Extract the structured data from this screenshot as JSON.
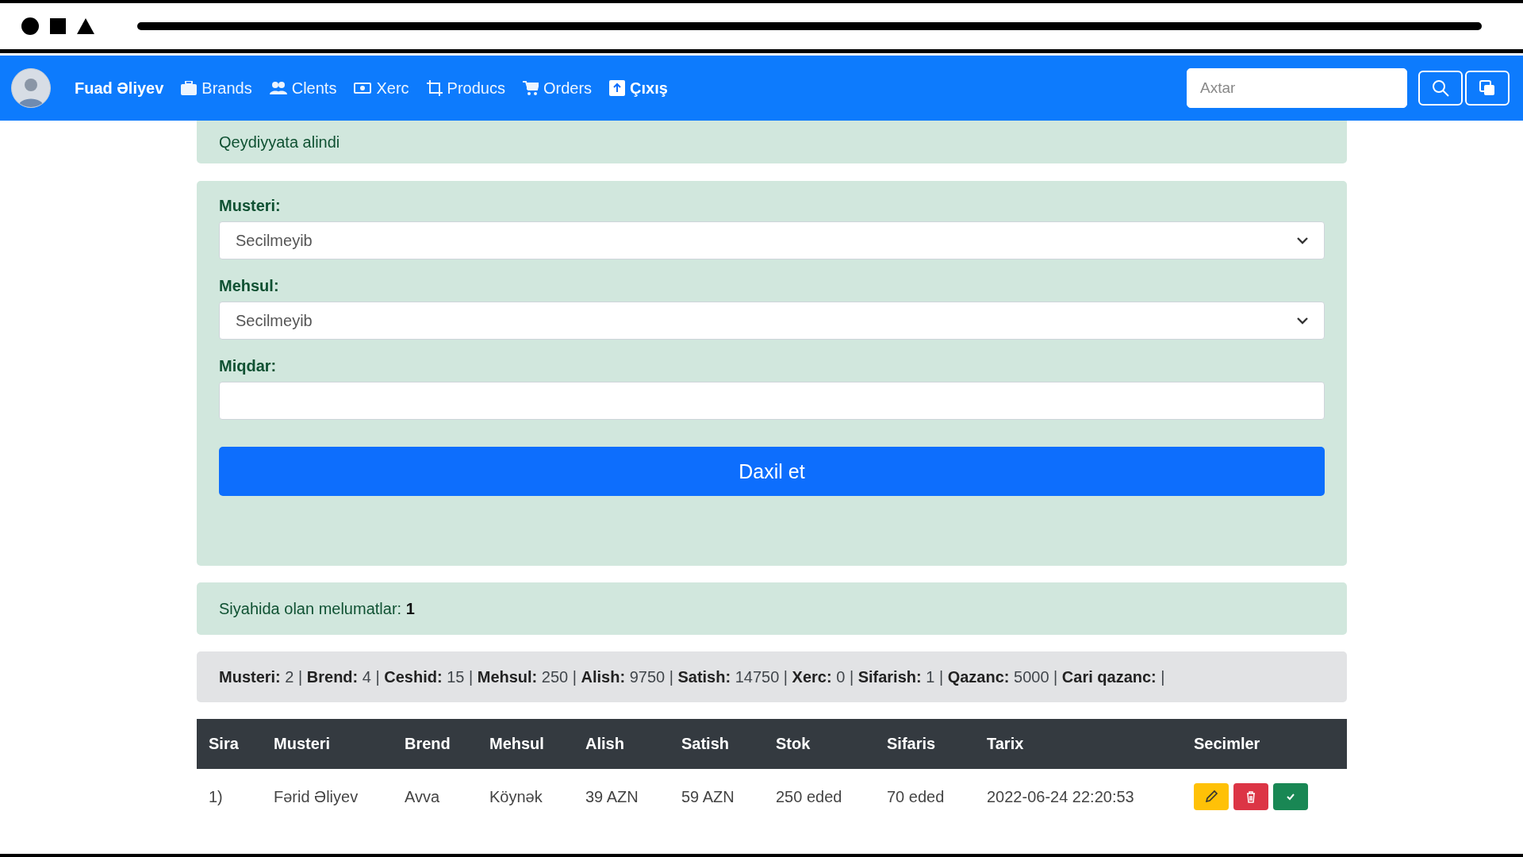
{
  "navbar": {
    "user": "Fuad Əliyev",
    "links": [
      {
        "kind": "brands",
        "label": "Brands"
      },
      {
        "kind": "clients",
        "label": "Clents"
      },
      {
        "kind": "expense",
        "label": "Xerc"
      },
      {
        "kind": "products",
        "label": "Producs"
      },
      {
        "kind": "orders",
        "label": "Orders"
      },
      {
        "kind": "logout",
        "label": "Çıxış"
      }
    ],
    "search": {
      "placeholder": "Axtar"
    }
  },
  "alert": {
    "text": "Qeydiyyata alindi"
  },
  "form": {
    "fields": [
      {
        "kind": "select",
        "label": "Musteri:",
        "value": "Secilmeyib"
      },
      {
        "kind": "select",
        "label": "Mehsul:",
        "value": "Secilmeyib"
      },
      {
        "kind": "input",
        "label": "Miqdar:"
      }
    ],
    "submit": "Daxil et"
  },
  "count_alert": {
    "text": "Siyahida olan melumatlar: **1**"
  },
  "stats": {
    "text": "**Musteri:** 2 | **Brend:** 4 | **Ceshid:** 15 | **Mehsul:** 250 | **Alish:** 9750 | **Satish:** 14750 | **Xerc:** 0 | **Sifarish:** 1 | **Qazanc:** 5000 | **Cari qazanc:** |"
  },
  "table": {
    "columns": [
      "Sira",
      "Musteri",
      "Brend",
      "Mehsul",
      "Alish",
      "Satish",
      "Stok",
      "Sifaris",
      "Tarix",
      "Secimler"
    ],
    "rows": [
      {
        "cells": [
          "1)",
          "Fərid Əliyev",
          "Avva",
          "Köynək",
          "39 AZN",
          "59 AZN",
          "250 eded",
          "70 eded",
          "2022-06-24 22:20:53"
        ],
        "actions": [
          {
            "kind": "edit"
          },
          {
            "kind": "delete"
          },
          {
            "kind": "confirm"
          }
        ]
      }
    ]
  }
}
